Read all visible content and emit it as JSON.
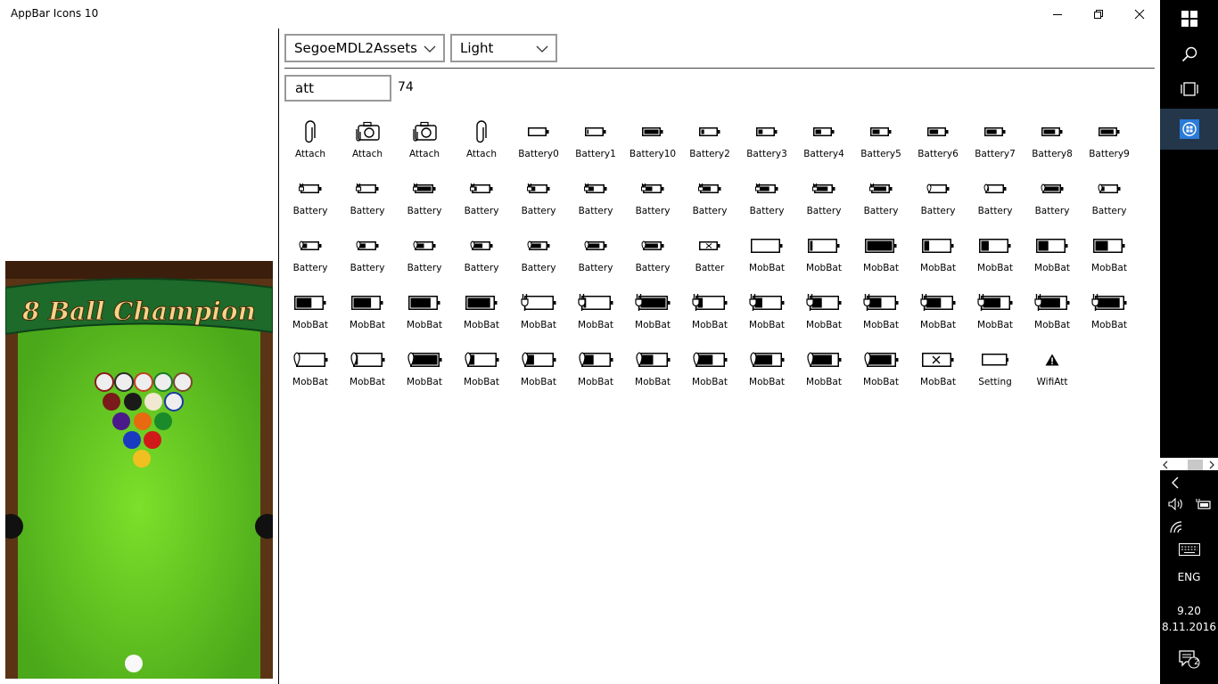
{
  "window": {
    "title": "AppBar Icons 10"
  },
  "controls": {
    "font_combo": "SegoeMDL2Assets",
    "theme_combo": "Light",
    "search_value": "att",
    "result_count": "74"
  },
  "icons": [
    {
      "label": "Attach",
      "icon": "paperclip"
    },
    {
      "label": "Attach",
      "icon": "camera-attach"
    },
    {
      "label": "Attach",
      "icon": "camera-attach"
    },
    {
      "label": "Attach",
      "icon": "paperclip"
    },
    {
      "label": "Battery0",
      "icon": "battery-small",
      "level": 0
    },
    {
      "label": "Battery1",
      "icon": "battery-small",
      "level": 0.1
    },
    {
      "label": "Battery10",
      "icon": "battery-small",
      "level": 1
    },
    {
      "label": "Battery2",
      "icon": "battery-small",
      "level": 0.2
    },
    {
      "label": "Battery3",
      "icon": "battery-small",
      "level": 0.3
    },
    {
      "label": "Battery4",
      "icon": "battery-small",
      "level": 0.4
    },
    {
      "label": "Battery5",
      "icon": "battery-small",
      "level": 0.5
    },
    {
      "label": "Battery6",
      "icon": "battery-small",
      "level": 0.6
    },
    {
      "label": "Battery7",
      "icon": "battery-small",
      "level": 0.7
    },
    {
      "label": "Battery8",
      "icon": "battery-small",
      "level": 0.8
    },
    {
      "label": "Battery9",
      "icon": "battery-small",
      "level": 0.9
    },
    {
      "label": "Battery",
      "icon": "battery-charging-small",
      "level": 0
    },
    {
      "label": "Battery",
      "icon": "battery-charging-small",
      "level": 0.1
    },
    {
      "label": "Battery",
      "icon": "battery-charging-small",
      "level": 1
    },
    {
      "label": "Battery",
      "icon": "battery-charging-small",
      "level": 0.2
    },
    {
      "label": "Battery",
      "icon": "battery-charging-small",
      "level": 0.3
    },
    {
      "label": "Battery",
      "icon": "battery-charging-small",
      "level": 0.4
    },
    {
      "label": "Battery",
      "icon": "battery-charging-small",
      "level": 0.5
    },
    {
      "label": "Battery",
      "icon": "battery-charging-small",
      "level": 0.6
    },
    {
      "label": "Battery",
      "icon": "battery-charging-small",
      "level": 0.7
    },
    {
      "label": "Battery",
      "icon": "battery-charging-small",
      "level": 0.8
    },
    {
      "label": "Battery",
      "icon": "battery-charging-small",
      "level": 0.9
    },
    {
      "label": "Battery",
      "icon": "battery-saver-small",
      "level": 0
    },
    {
      "label": "Battery",
      "icon": "battery-saver-small",
      "level": 0.1
    },
    {
      "label": "Battery",
      "icon": "battery-saver-small",
      "level": 1
    },
    {
      "label": "Battery",
      "icon": "battery-saver-small",
      "level": 0.2
    },
    {
      "label": "Battery",
      "icon": "battery-saver-small",
      "level": 0.3
    },
    {
      "label": "Battery",
      "icon": "battery-saver-small",
      "level": 0.4
    },
    {
      "label": "Battery",
      "icon": "battery-saver-small",
      "level": 0.5
    },
    {
      "label": "Battery",
      "icon": "battery-saver-small",
      "level": 0.6
    },
    {
      "label": "Battery",
      "icon": "battery-saver-small",
      "level": 0.7
    },
    {
      "label": "Battery",
      "icon": "battery-saver-small",
      "level": 0.8
    },
    {
      "label": "Battery",
      "icon": "battery-saver-small",
      "level": 0.9
    },
    {
      "label": "Batter",
      "icon": "battery-unknown-small"
    },
    {
      "label": "MobBat",
      "icon": "battery-large",
      "level": 0
    },
    {
      "label": "MobBat",
      "icon": "battery-large",
      "level": 0.1
    },
    {
      "label": "MobBat",
      "icon": "battery-large",
      "level": 1
    },
    {
      "label": "MobBat",
      "icon": "battery-large",
      "level": 0.2
    },
    {
      "label": "MobBat",
      "icon": "battery-large",
      "level": 0.3
    },
    {
      "label": "MobBat",
      "icon": "battery-large",
      "level": 0.4
    },
    {
      "label": "MobBat",
      "icon": "battery-large",
      "level": 0.5
    },
    {
      "label": "MobBat",
      "icon": "battery-large",
      "level": 0.6
    },
    {
      "label": "MobBat",
      "icon": "battery-large",
      "level": 0.7
    },
    {
      "label": "MobBat",
      "icon": "battery-large",
      "level": 0.8
    },
    {
      "label": "MobBat",
      "icon": "battery-large",
      "level": 0.9
    },
    {
      "label": "MobBat",
      "icon": "battery-charging-large",
      "level": 0
    },
    {
      "label": "MobBat",
      "icon": "battery-charging-large",
      "level": 0.1
    },
    {
      "label": "MobBat",
      "icon": "battery-charging-large",
      "level": 1
    },
    {
      "label": "MobBat",
      "icon": "battery-charging-large",
      "level": 0.2
    },
    {
      "label": "MobBat",
      "icon": "battery-charging-large",
      "level": 0.3
    },
    {
      "label": "MobBat",
      "icon": "battery-charging-large",
      "level": 0.4
    },
    {
      "label": "MobBat",
      "icon": "battery-charging-large",
      "level": 0.5
    },
    {
      "label": "MobBat",
      "icon": "battery-charging-large",
      "level": 0.6
    },
    {
      "label": "MobBat",
      "icon": "battery-charging-large",
      "level": 0.7
    },
    {
      "label": "MobBat",
      "icon": "battery-charging-large",
      "level": 0.8
    },
    {
      "label": "MobBat",
      "icon": "battery-charging-large",
      "level": 0.9
    },
    {
      "label": "MobBat",
      "icon": "battery-saver-large",
      "level": 0
    },
    {
      "label": "MobBat",
      "icon": "battery-saver-large",
      "level": 0.1
    },
    {
      "label": "MobBat",
      "icon": "battery-saver-large",
      "level": 1
    },
    {
      "label": "MobBat",
      "icon": "battery-saver-large",
      "level": 0.2
    },
    {
      "label": "MobBat",
      "icon": "battery-saver-large",
      "level": 0.3
    },
    {
      "label": "MobBat",
      "icon": "battery-saver-large",
      "level": 0.4
    },
    {
      "label": "MobBat",
      "icon": "battery-saver-large",
      "level": 0.5
    },
    {
      "label": "MobBat",
      "icon": "battery-saver-large",
      "level": 0.6
    },
    {
      "label": "MobBat",
      "icon": "battery-saver-large",
      "level": 0.7
    },
    {
      "label": "MobBat",
      "icon": "battery-saver-large",
      "level": 0.8
    },
    {
      "label": "MobBat",
      "icon": "battery-saver-large",
      "level": 0.9
    },
    {
      "label": "MobBat",
      "icon": "battery-unknown-large"
    },
    {
      "label": "Setting",
      "icon": "battery-setting"
    },
    {
      "label": "WifiAtt",
      "icon": "warning-triangle"
    }
  ],
  "ad": {
    "title": "8 Ball Champion"
  },
  "taskbar": {
    "language": "ENG",
    "time": "9.20",
    "date": "8.11.2016",
    "notification_count": "2"
  }
}
